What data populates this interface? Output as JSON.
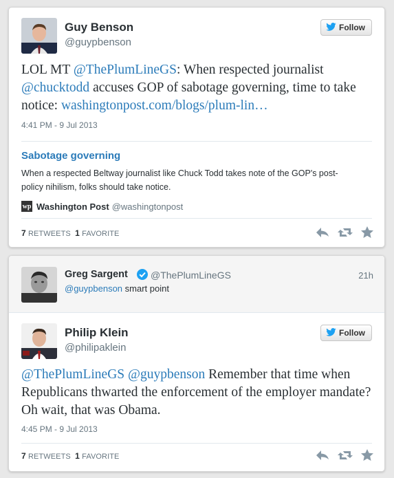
{
  "colors": {
    "link": "#2b7bb9",
    "verified": "#1da1f2",
    "bird": "#1da1f2"
  },
  "tweet1": {
    "author_name": "Guy Benson",
    "author_handle": "@guypbenson",
    "follow_label": "Follow",
    "text_prefix": "LOL MT ",
    "mention1": "@ThePlumLineGS",
    "text_mid1": ": When respected journalist ",
    "mention2": "@chucktodd",
    "text_mid2": " accuses GOP of sabotage governing, time to take notice: ",
    "link": "washingtonpost.com/blogs/plum-lin…",
    "timestamp": "4:41 PM - 9 Jul 2013",
    "summary_title": "Sabotage governing",
    "summary_desc": "When a respected Beltway journalist like Chuck Todd takes note of the GOP's post-policy nihilism, folks should take notice.",
    "source_logo": "wp",
    "source_name": "Washington Post",
    "source_handle": "@washingtonpost",
    "retweets_count": "7",
    "retweets_label": "RETWEETS",
    "favorites_count": "1",
    "favorites_label": "FAVORITE"
  },
  "reply": {
    "author_name": "Greg Sargent",
    "author_handle": "@ThePlumLineGS",
    "age": "21h",
    "mention": "@guypbenson",
    "text": " smart point"
  },
  "tweet2": {
    "author_name": "Philip Klein",
    "author_handle": "@philipaklein",
    "follow_label": "Follow",
    "mention1": "@ThePlumLineGS",
    "mention2": "@guypbenson",
    "text": " Remember that time when Republicans thwarted the enforcement of the employer mandate? Oh wait, that was Obama.",
    "timestamp": "4:45 PM - 9 Jul 2013",
    "retweets_count": "7",
    "retweets_label": "RETWEETS",
    "favorites_count": "1",
    "favorites_label": "FAVORITE"
  }
}
